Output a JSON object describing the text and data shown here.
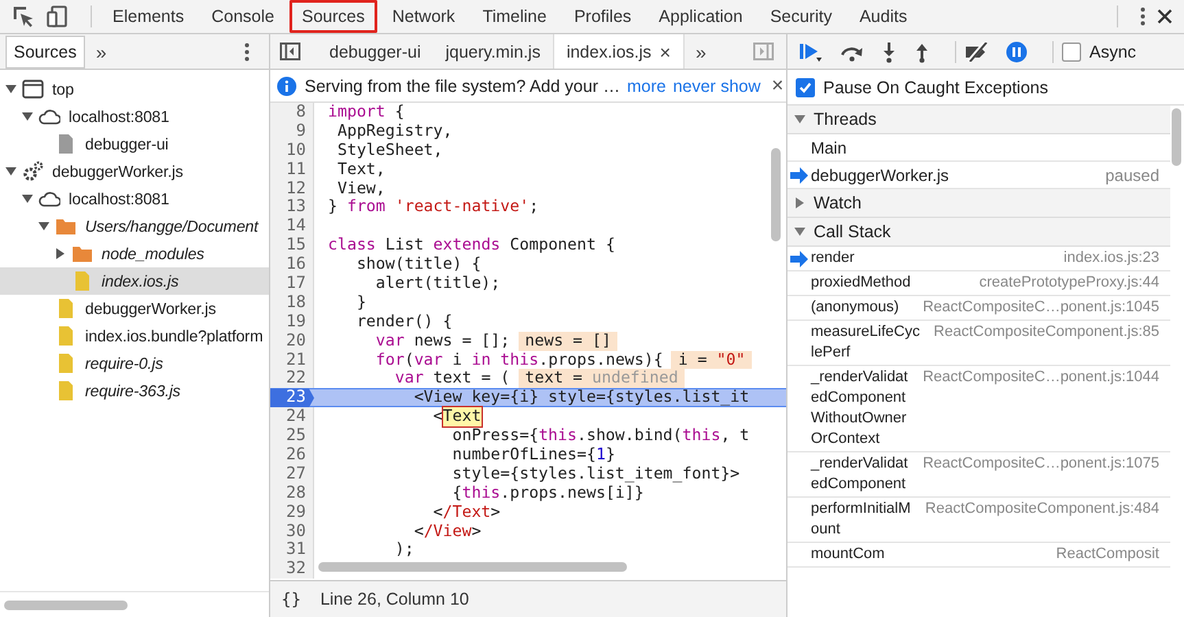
{
  "main_tabs": [
    {
      "label": "Elements",
      "selected": false
    },
    {
      "label": "Console",
      "selected": false
    },
    {
      "label": "Sources",
      "selected": true
    },
    {
      "label": "Network",
      "selected": false
    },
    {
      "label": "Timeline",
      "selected": false
    },
    {
      "label": "Profiles",
      "selected": false
    },
    {
      "label": "Application",
      "selected": false
    },
    {
      "label": "Security",
      "selected": false
    },
    {
      "label": "Audits",
      "selected": false
    }
  ],
  "navigator": {
    "tabs": [
      {
        "label": "Sources",
        "selected": true
      }
    ],
    "more": "»",
    "tree": [
      {
        "label": "top",
        "kind": "window",
        "expanded": true,
        "selected": false,
        "italic": false,
        "children": [
          {
            "label": "localhost:8081",
            "kind": "cloud",
            "expanded": true,
            "selected": false,
            "italic": false,
            "children": [
              {
                "label": "debugger-ui",
                "kind": "page",
                "selected": false,
                "italic": false
              }
            ]
          }
        ]
      },
      {
        "label": "debuggerWorker.js",
        "kind": "worker",
        "expanded": true,
        "selected": false,
        "italic": false,
        "children": [
          {
            "label": "localhost:8081",
            "kind": "cloud",
            "expanded": true,
            "selected": false,
            "italic": false,
            "children": [
              {
                "label": "Users/hangge/Document",
                "kind": "folder",
                "expanded": true,
                "selected": false,
                "italic": true,
                "children": [
                  {
                    "label": "node_modules",
                    "kind": "folder",
                    "expanded": false,
                    "selected": false,
                    "italic": true
                  },
                  {
                    "label": "index.ios.js",
                    "kind": "script",
                    "selected": true,
                    "italic": true
                  }
                ]
              },
              {
                "label": "debuggerWorker.js",
                "kind": "script",
                "selected": false,
                "italic": false
              },
              {
                "label": "index.ios.bundle?platform",
                "kind": "script",
                "selected": false,
                "italic": false
              },
              {
                "label": "require-0.js",
                "kind": "script",
                "selected": false,
                "italic": true
              },
              {
                "label": "require-363.js",
                "kind": "script",
                "selected": false,
                "italic": true
              }
            ]
          }
        ]
      }
    ]
  },
  "editor": {
    "tabs": [
      {
        "label": "debugger-ui",
        "selected": false
      },
      {
        "label": "jquery.min.js",
        "selected": false
      },
      {
        "label": "index.ios.js",
        "selected": true,
        "close": "×"
      }
    ],
    "more": "»",
    "infobar": {
      "message": "Serving from the file system? Add your …",
      "links": [
        "more",
        "never show"
      ],
      "close": "×"
    },
    "lines": [
      {
        "number": "8",
        "current": false,
        "tokens": [
          {
            "kind": "keyword",
            "text": "import"
          },
          {
            "kind": "plain",
            "text": " {"
          }
        ]
      },
      {
        "number": "9",
        "current": false,
        "tokens": [
          {
            "kind": "plain",
            "text": " AppRegistry,"
          }
        ]
      },
      {
        "number": "10",
        "current": false,
        "tokens": [
          {
            "kind": "plain",
            "text": " StyleSheet,"
          }
        ]
      },
      {
        "number": "11",
        "current": false,
        "tokens": [
          {
            "kind": "plain",
            "text": " Text,"
          }
        ]
      },
      {
        "number": "12",
        "current": false,
        "tokens": [
          {
            "kind": "plain",
            "text": " View,"
          }
        ]
      },
      {
        "number": "13",
        "current": false,
        "tokens": [
          {
            "kind": "plain",
            "text": "} "
          },
          {
            "kind": "keyword",
            "text": "from"
          },
          {
            "kind": "string",
            "text": " 'react-native'"
          },
          {
            "kind": "plain",
            "text": ";"
          }
        ]
      },
      {
        "number": "14",
        "current": false
      },
      {
        "number": "15",
        "current": false,
        "tokens": [
          {
            "kind": "keyword",
            "text": "class"
          },
          {
            "kind": "plain",
            "text": " List "
          },
          {
            "kind": "keyword",
            "text": "extends"
          },
          {
            "kind": "plain",
            "text": " Component {"
          }
        ]
      },
      {
        "number": "16",
        "current": false,
        "tokens": [
          {
            "kind": "plain",
            "text": "   show(title) {"
          }
        ]
      },
      {
        "number": "17",
        "current": false,
        "tokens": [
          {
            "kind": "plain",
            "text": "     alert(title);"
          }
        ]
      },
      {
        "number": "18",
        "current": false,
        "tokens": [
          {
            "kind": "plain",
            "text": "   }"
          }
        ]
      },
      {
        "number": "19",
        "current": false,
        "tokens": [
          {
            "kind": "plain",
            "text": "   render() {"
          }
        ]
      },
      {
        "number": "20",
        "current": false,
        "tokens": [
          {
            "kind": "keyword",
            "text": "     var"
          },
          {
            "kind": "plain",
            "text": " news = [];"
          },
          {
            "kind": "value",
            "parts": [
              {
                "kind": "plain",
                "text": "news = []"
              }
            ]
          }
        ]
      },
      {
        "number": "21",
        "current": false,
        "tokens": [
          {
            "kind": "keyword",
            "text": "     for"
          },
          {
            "kind": "plain",
            "text": "("
          },
          {
            "kind": "keyword",
            "text": "var"
          },
          {
            "kind": "plain",
            "text": " i "
          },
          {
            "kind": "keyword",
            "text": "in this"
          },
          {
            "kind": "plain",
            "text": ".props.news){"
          },
          {
            "kind": "value",
            "parts": [
              {
                "kind": "plain",
                "text": "i = "
              },
              {
                "kind": "string",
                "text": "\"0\""
              }
            ]
          }
        ]
      },
      {
        "number": "22",
        "current": false,
        "tokens": [
          {
            "kind": "keyword",
            "text": "       var"
          },
          {
            "kind": "plain",
            "text": " text = ("
          },
          {
            "kind": "value",
            "parts": [
              {
                "kind": "plain",
                "text": "text = "
              },
              {
                "kind": "undefined",
                "text": "undefined"
              }
            ]
          }
        ]
      },
      {
        "number": "23",
        "current": true,
        "tokens": [
          {
            "kind": "plain",
            "text": "         <View key={i} style={styles.list_it"
          }
        ]
      },
      {
        "number": "24",
        "current": false,
        "tokens": [
          {
            "kind": "plain",
            "text": "           <"
          },
          {
            "kind": "match",
            "text": "Text"
          }
        ]
      },
      {
        "number": "25",
        "current": false,
        "tokens": [
          {
            "kind": "plain",
            "text": "             onPress={"
          },
          {
            "kind": "keyword",
            "text": "this"
          },
          {
            "kind": "plain",
            "text": ".show.bind("
          },
          {
            "kind": "keyword",
            "text": "this"
          },
          {
            "kind": "plain",
            "text": ", t"
          }
        ]
      },
      {
        "number": "26",
        "current": false,
        "tokens": [
          {
            "kind": "plain",
            "text": "             numberOfLines={"
          },
          {
            "kind": "number",
            "text": "1"
          },
          {
            "kind": "plain",
            "text": "}"
          }
        ]
      },
      {
        "number": "27",
        "current": false,
        "tokens": [
          {
            "kind": "plain",
            "text": "             style={styles.list_item_font}>"
          }
        ]
      },
      {
        "number": "28",
        "current": false,
        "tokens": [
          {
            "kind": "plain",
            "text": "             {"
          },
          {
            "kind": "keyword",
            "text": "this"
          },
          {
            "kind": "plain",
            "text": ".props.news[i]}"
          }
        ]
      },
      {
        "number": "29",
        "current": false,
        "tokens": [
          {
            "kind": "plain",
            "text": "           <"
          },
          {
            "kind": "tag",
            "text": "/Text"
          },
          {
            "kind": "plain",
            "text": ">"
          }
        ]
      },
      {
        "number": "30",
        "current": false,
        "tokens": [
          {
            "kind": "plain",
            "text": "         <"
          },
          {
            "kind": "tag",
            "text": "/View"
          },
          {
            "kind": "plain",
            "text": ">"
          }
        ]
      },
      {
        "number": "31",
        "current": false,
        "tokens": [
          {
            "kind": "plain",
            "text": "       );"
          }
        ]
      },
      {
        "number": "32",
        "current": false
      }
    ],
    "status": {
      "format": "{}",
      "position": "Line 26, Column 10"
    }
  },
  "debugger": {
    "async": {
      "label": "Async",
      "checked": false
    },
    "pause_on_caught": {
      "label": "Pause On Caught Exceptions",
      "checked": true
    },
    "sections": [
      {
        "title": "Threads",
        "expanded": true,
        "kind": "threads",
        "items": [
          {
            "name": "Main",
            "current": false
          },
          {
            "name": "debuggerWorker.js",
            "current": true,
            "status": "paused"
          }
        ]
      },
      {
        "title": "Watch",
        "expanded": false,
        "kind": "watch"
      },
      {
        "title": "Call Stack",
        "expanded": true,
        "kind": "frames",
        "items": [
          {
            "name": "render",
            "location": "index.ios.js:23",
            "current": true
          },
          {
            "name": "proxiedMethod",
            "location": "createPrototypeProxy.js:44",
            "current": false
          },
          {
            "name": "(anonymous)",
            "location": "ReactCompositeC…ponent.js:1045",
            "current": false
          },
          {
            "name": "measureLifeCyclePerf",
            "location": "ReactCompositeComponent.js:85",
            "current": false
          },
          {
            "name": "_renderValidatedComponentWithoutOwnerOrContext",
            "location": "ReactCompositeC…ponent.js:1044",
            "current": false
          },
          {
            "name": "_renderValidatedComponent",
            "location": "ReactCompositeC…ponent.js:1075",
            "current": false
          },
          {
            "name": "performInitialMount",
            "location": "ReactCompositeComponent.js:484",
            "current": false
          },
          {
            "name": "mountCom",
            "location": "ReactComposit",
            "current": false
          }
        ]
      }
    ]
  }
}
